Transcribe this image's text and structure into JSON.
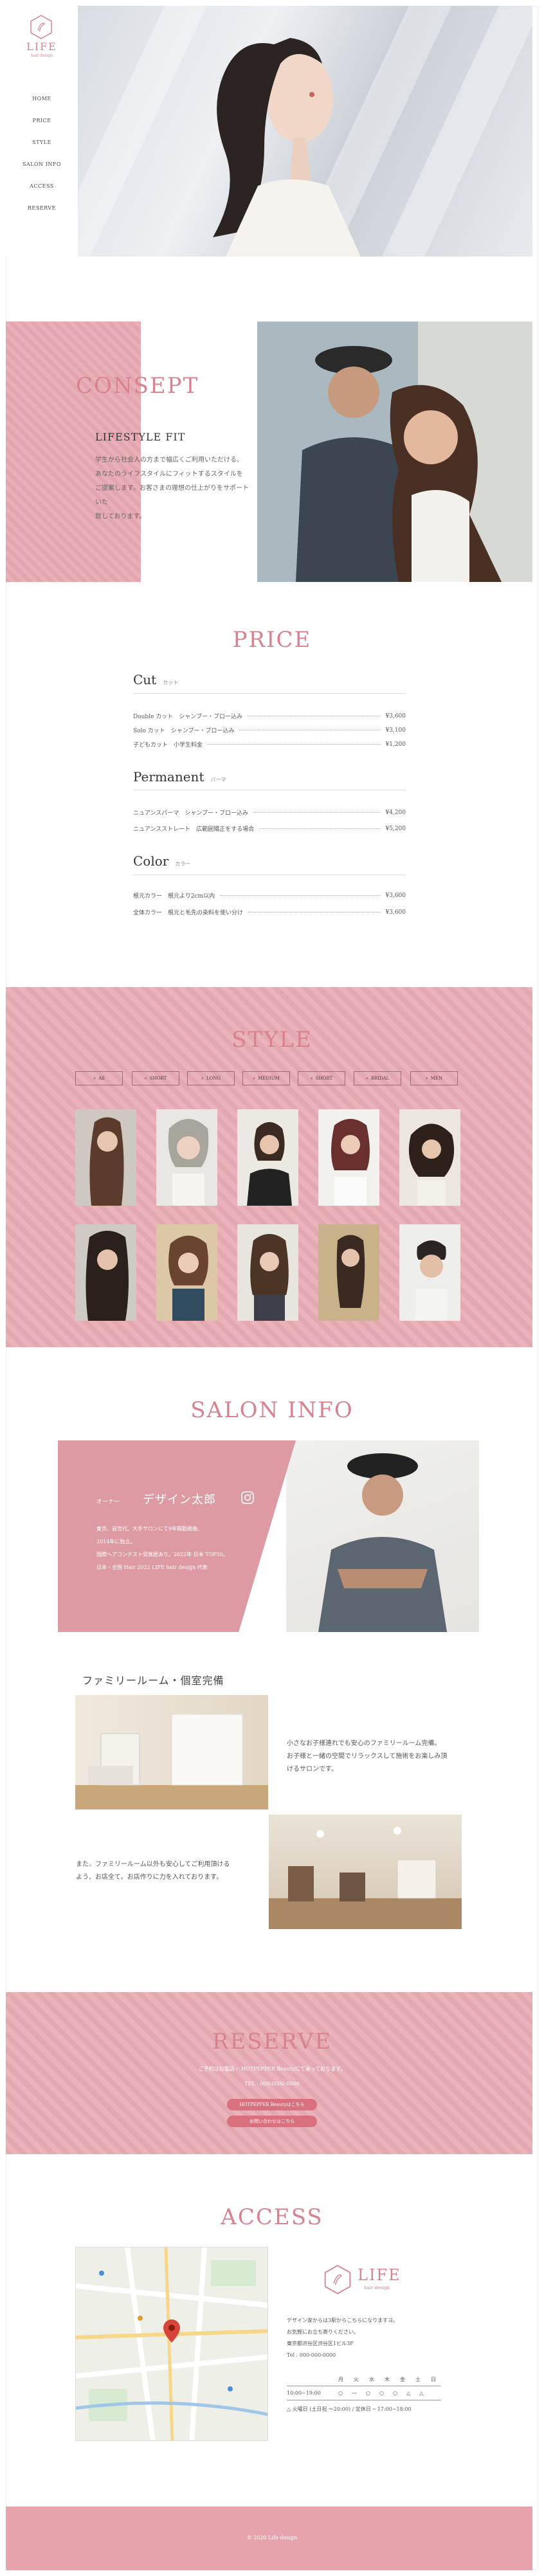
{
  "brand": {
    "name": "LIFE",
    "tagline": "hair design"
  },
  "nav": [
    "HOME",
    "PRICE",
    "STYLE",
    "SALON INFO",
    "ACCESS",
    "RESERVE"
  ],
  "concept": {
    "title": "CONSEPT",
    "subtitle": "LIFESTYLE FIT",
    "body": [
      "学生から社会人の方まで幅広くご利用いただける、",
      "あなたのライフスタイルにフィットするスタイルを",
      "ご提案します。お客さまの理想の仕上がりをサポートいた",
      "致しております。"
    ]
  },
  "price": {
    "title": "PRICE",
    "categories": [
      {
        "name": "Cut",
        "sub": "カット",
        "items": [
          {
            "name": "Double カット　シャンプー・ブロー込み",
            "price": "¥3,600"
          },
          {
            "name": "Solo カット　シャンプー・ブロー込み",
            "price": "¥3,100"
          },
          {
            "name": "子どもカット　小学生料金",
            "price": "¥1,200"
          }
        ]
      },
      {
        "name": "Permanent",
        "sub": "パーマ",
        "items": [
          {
            "name": "ニュアンスパーマ　シャンプー・ブロー込み",
            "price": "¥4,200"
          },
          {
            "name": "ニュアンスストレート　広範囲矯正をする場合",
            "price": "¥5,200"
          }
        ]
      },
      {
        "name": "Color",
        "sub": "カラー",
        "items": [
          {
            "name": "根元カラー　根元より2cm以内",
            "price": "¥3,600"
          },
          {
            "name": "全体カラー　根元と毛先の染料を使い分け",
            "price": "¥3,600"
          }
        ]
      }
    ]
  },
  "style": {
    "title": "STYLE",
    "tabs": [
      "All",
      "SHORT",
      "LONG",
      "MEDIUM",
      "SHORT",
      "BRIDAL",
      "MEN"
    ]
  },
  "salon": {
    "title": "SALON INFO",
    "owner_role": "オーナー",
    "owner_name": "デザイン太郎",
    "owner_bio": [
      "東京、芸世代、大手サロンにて9年間勤務後、",
      "2014年に独立。",
      "国際ヘアコンテスト受賞歴あり。2022年 日本 TOP50。",
      "日本・全国 Hair 2022 LIFE hair design 代表"
    ],
    "room_title": "ファミリールーム・個室完備",
    "room_text_1": [
      "小さなお子様連れでも安心のファミリールーム完備。",
      "お子様と一緒の空間でリラックスして施術をお楽しみ頂",
      "けるサロンです。"
    ],
    "room_text_2": [
      "また、ファミリールーム以外も安心してご利用頂ける",
      "よう、お店全て。お店作りに力を入れております。"
    ]
  },
  "reserve": {
    "title": "RESERVE",
    "line1": "ご予約はお電話・ HOTPEPPER Beautyにて承っております。",
    "tel": "TEL : 000-0000-0000",
    "btn1": "HOTPEPPER Beautyはこちら",
    "btn2": "お問い合わせはこちら"
  },
  "access": {
    "title": "ACCESS",
    "lines": [
      "デザイン家からは3駅からこちらになりますヨ。",
      "お気軽にお立ち寄りください。",
      "東京都渋谷区渋谷区1ビル3F",
      "Tel : 000-000-0000"
    ],
    "days": [
      "月",
      "火",
      "水",
      "木",
      "金",
      "土",
      "日"
    ],
    "hours_label": "10:00~19:00",
    "holiday": "△ 火曜日 (土日祝 〜20:00) / 定休日 ─ 17:00~18:00"
  },
  "footer": {
    "copyright": "© 2020 Life design"
  },
  "colors": {
    "accent": "#d9828f",
    "pink_bg": "#e6a9b0"
  }
}
